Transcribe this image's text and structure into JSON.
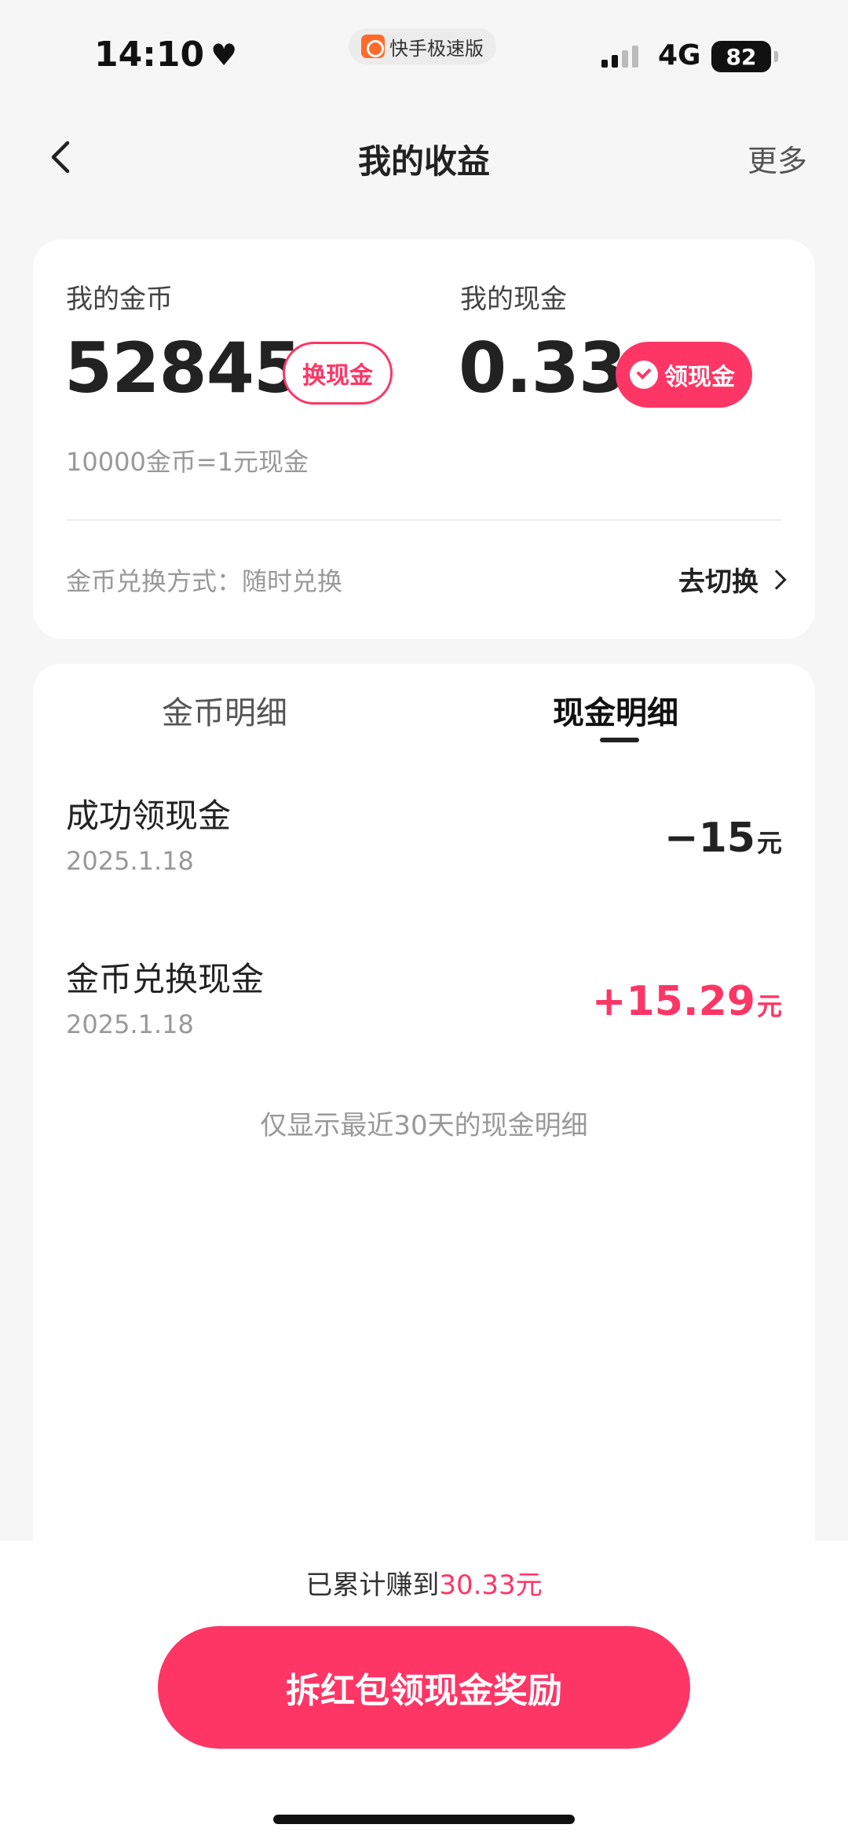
{
  "status_bar": {
    "time": "14:10",
    "app_name": "快手极速版",
    "network": "4G",
    "battery": "82"
  },
  "nav": {
    "title": "我的收益",
    "more": "更多"
  },
  "summary": {
    "coins_label": "我的金币",
    "coins_value": "52845",
    "exchange_button": "换现金",
    "cash_label": "我的现金",
    "cash_value": "0.33",
    "withdraw_button": "领现金",
    "rate": "10000金币=1元现金",
    "method": "金币兑换方式：随时兑换",
    "switch": "去切换"
  },
  "tabs": [
    {
      "label": "金币明细",
      "active": false
    },
    {
      "label": "现金明细",
      "active": true
    }
  ],
  "records": [
    {
      "title": "成功领现金",
      "date": "2025.1.18",
      "amount": "−15",
      "unit": "元"
    },
    {
      "title": "金币兑换现金",
      "date": "2025.1.18",
      "amount": "+15.29",
      "unit": "元"
    }
  ],
  "footnote": "仅显示最近30天的现金明细",
  "bottom": {
    "earned_prefix": "已累计赚到",
    "earned_amount": "30.33元",
    "cta": "拆红包领现金奖励"
  },
  "colors": {
    "accent": "#fe3666",
    "background": "#f6f6f7"
  }
}
